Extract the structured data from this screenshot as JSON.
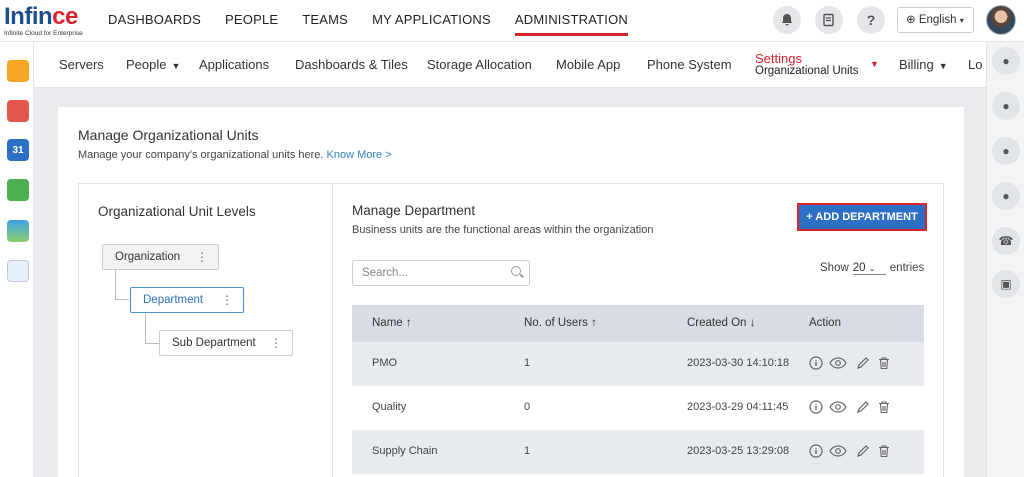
{
  "brand": {
    "logo_main_a": "Inf",
    "logo_main_b": "in",
    "logo_main_c": "ce",
    "logo_sub": "Infinite Cloud for Enterprise"
  },
  "topnav": [
    "DASHBOARDS",
    "PEOPLE",
    "TEAMS",
    "MY APPLICATIONS",
    "ADMINISTRATION"
  ],
  "topnav_active": "ADMINISTRATION",
  "header": {
    "language": "English"
  },
  "subnav": {
    "servers": "Servers",
    "people": "People",
    "applications": "Applications",
    "dashboards": "Dashboards & Tiles",
    "storage": "Storage Allocation",
    "mobile": "Mobile App",
    "phone": "Phone System",
    "settings": "Settings",
    "settings_sub": "Organizational Units",
    "billing": "Billing",
    "lo": "Lo"
  },
  "page": {
    "title": "Manage Organizational Units",
    "subtitle": "Manage your company's organizational units here.",
    "know_more": "Know More >"
  },
  "levels": {
    "title": "Organizational Unit Levels",
    "nodes": [
      "Organization",
      "Department",
      "Sub Department"
    ]
  },
  "department": {
    "title": "Manage Department",
    "subtitle": "Business units are the functional areas within the organization",
    "add_button": "+ ADD DEPARTMENT",
    "search_placeholder": "Search...",
    "show_label": "Show",
    "entries_value": "20",
    "entries_label": "entries"
  },
  "table": {
    "columns": [
      "Name ↑",
      "No. of Users ↑",
      "Created On ↓",
      "Action"
    ],
    "rows": [
      {
        "name": "PMO",
        "users": "1",
        "created": "2023-03-30 14:10:18"
      },
      {
        "name": "Quality",
        "users": "0",
        "created": "2023-03-29 04:11:45"
      },
      {
        "name": "Supply Chain",
        "users": "1",
        "created": "2023-03-25 13:29:08"
      }
    ]
  },
  "colors": {
    "accent": "#d9232d",
    "primary": "#2d6fc4",
    "header_row": "#d8dde5",
    "alt_row": "#e7eaef"
  }
}
